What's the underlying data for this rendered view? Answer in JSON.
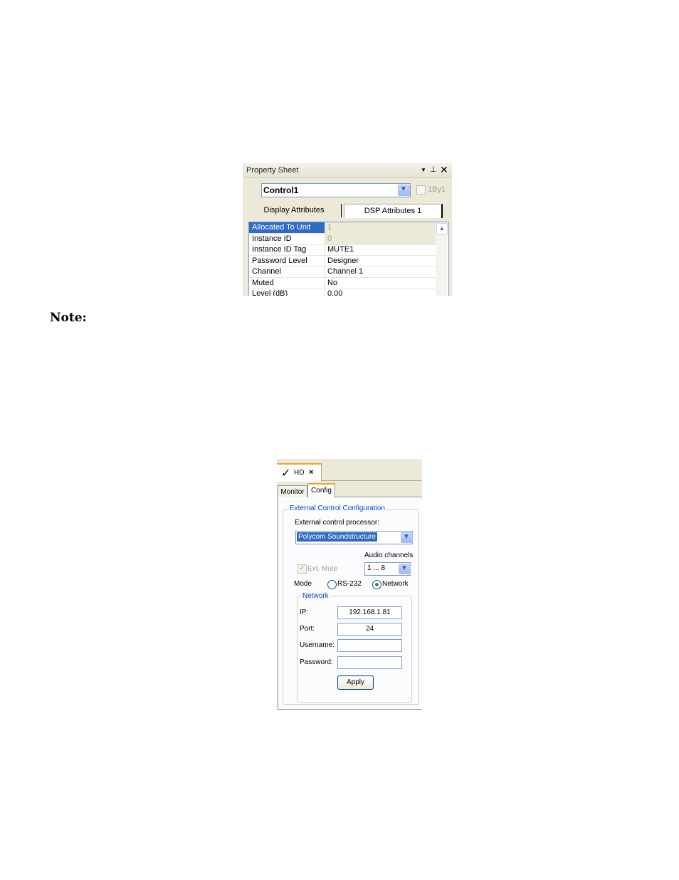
{
  "property_sheet": {
    "title": "Property Sheet",
    "control_select": "Control1",
    "checkbox_label": "1By1",
    "tabs": [
      "Display Attributes",
      "DSP Attributes 1"
    ],
    "rows": [
      {
        "key": "Allocated To Unit",
        "value": "1"
      },
      {
        "key": "Instance ID",
        "value": "0"
      },
      {
        "key": "Instance ID Tag",
        "value": "MUTE1"
      },
      {
        "key": "Password Level",
        "value": "Designer"
      },
      {
        "key": "Channel",
        "value": "Channel 1"
      },
      {
        "key": "Muted",
        "value": "No"
      },
      {
        "key": "Level (dB)",
        "value": "0.00"
      }
    ]
  },
  "note_label": "Note:",
  "hd_panel": {
    "doc_tab": "HD",
    "tabs": [
      "Monitor",
      "Config"
    ],
    "group_title": "External Control Configuration",
    "processor_label": "External control processor:",
    "processor_value": "Polycom Soundstructure",
    "audio_channels_label": "Audio channels",
    "audio_channels_value": "1 ... 8",
    "ext_mute_label": "Ext. Mute",
    "mode_label": "Mode",
    "mode_options": [
      "RS-232",
      "Network"
    ],
    "network_group": "Network",
    "ip_label": "IP:",
    "ip_value": "192.168.1.81",
    "port_label": "Port:",
    "port_value": "24",
    "username_label": "Username:",
    "password_label": "Password:",
    "apply_label": "Apply"
  }
}
